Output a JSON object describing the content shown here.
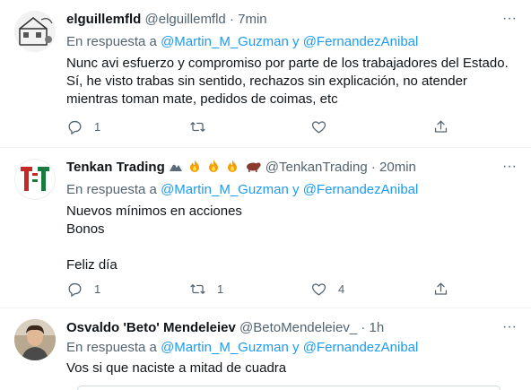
{
  "tweets": [
    {
      "display_name": "elguillemfld",
      "handle": "@elguillemfld",
      "separator": "·",
      "time": "7min",
      "reply_prefix": "En respuesta a",
      "reply_to_1": "@Martin_M_Guzman",
      "reply_join": "y",
      "reply_to_2": "@FernandezAnibal",
      "lines": [
        "Nunc avi esfuerzo y compromiso por parte de los trabajadores del Estado.",
        "Sí, he visto trabas sin sentido, rechazos sin explicación, no atender",
        "mientras toman mate, pedidos de coimas, etc"
      ],
      "replies": "1",
      "retweets": "",
      "likes": "",
      "avatar_icon": "sketch-avatar-icon"
    },
    {
      "display_name": "Tenkan Trading",
      "handle": "@TenkanTrading",
      "separator": "·",
      "time": "20min",
      "reply_prefix": "En respuesta a",
      "reply_to_1": "@Martin_M_Guzman",
      "reply_join": "y",
      "reply_to_2": "@FernandezAnibal",
      "lines": [
        "Nuevos mínimos en acciones",
        "Bonos",
        "",
        "Feliz día"
      ],
      "replies": "1",
      "retweets": "1",
      "likes": "4",
      "avatar_icon": "tt-logo-icon",
      "name_emojis": [
        "mountain-icon",
        "fire-icon",
        "fire-icon",
        "fire-icon",
        "bull-icon"
      ]
    },
    {
      "display_name": "Osvaldo 'Beto' Mendeleiev",
      "handle": "@BetoMendeleiev_",
      "separator": "·",
      "time": "1h",
      "reply_prefix": "En respuesta a",
      "reply_to_1": "@Martin_M_Guzman",
      "reply_join": "y",
      "reply_to_2": "@FernandezAnibal",
      "lines": [
        "Vos si que naciste a mitad de cuadra"
      ],
      "avatar_icon": "photo-avatar-icon"
    }
  ],
  "colors": {
    "link": "#1d9bf0",
    "muted": "#536471",
    "text": "#0f1419",
    "fire": "#f59e0b",
    "logo_red": "#c62828",
    "logo_green": "#1b7a3d"
  }
}
